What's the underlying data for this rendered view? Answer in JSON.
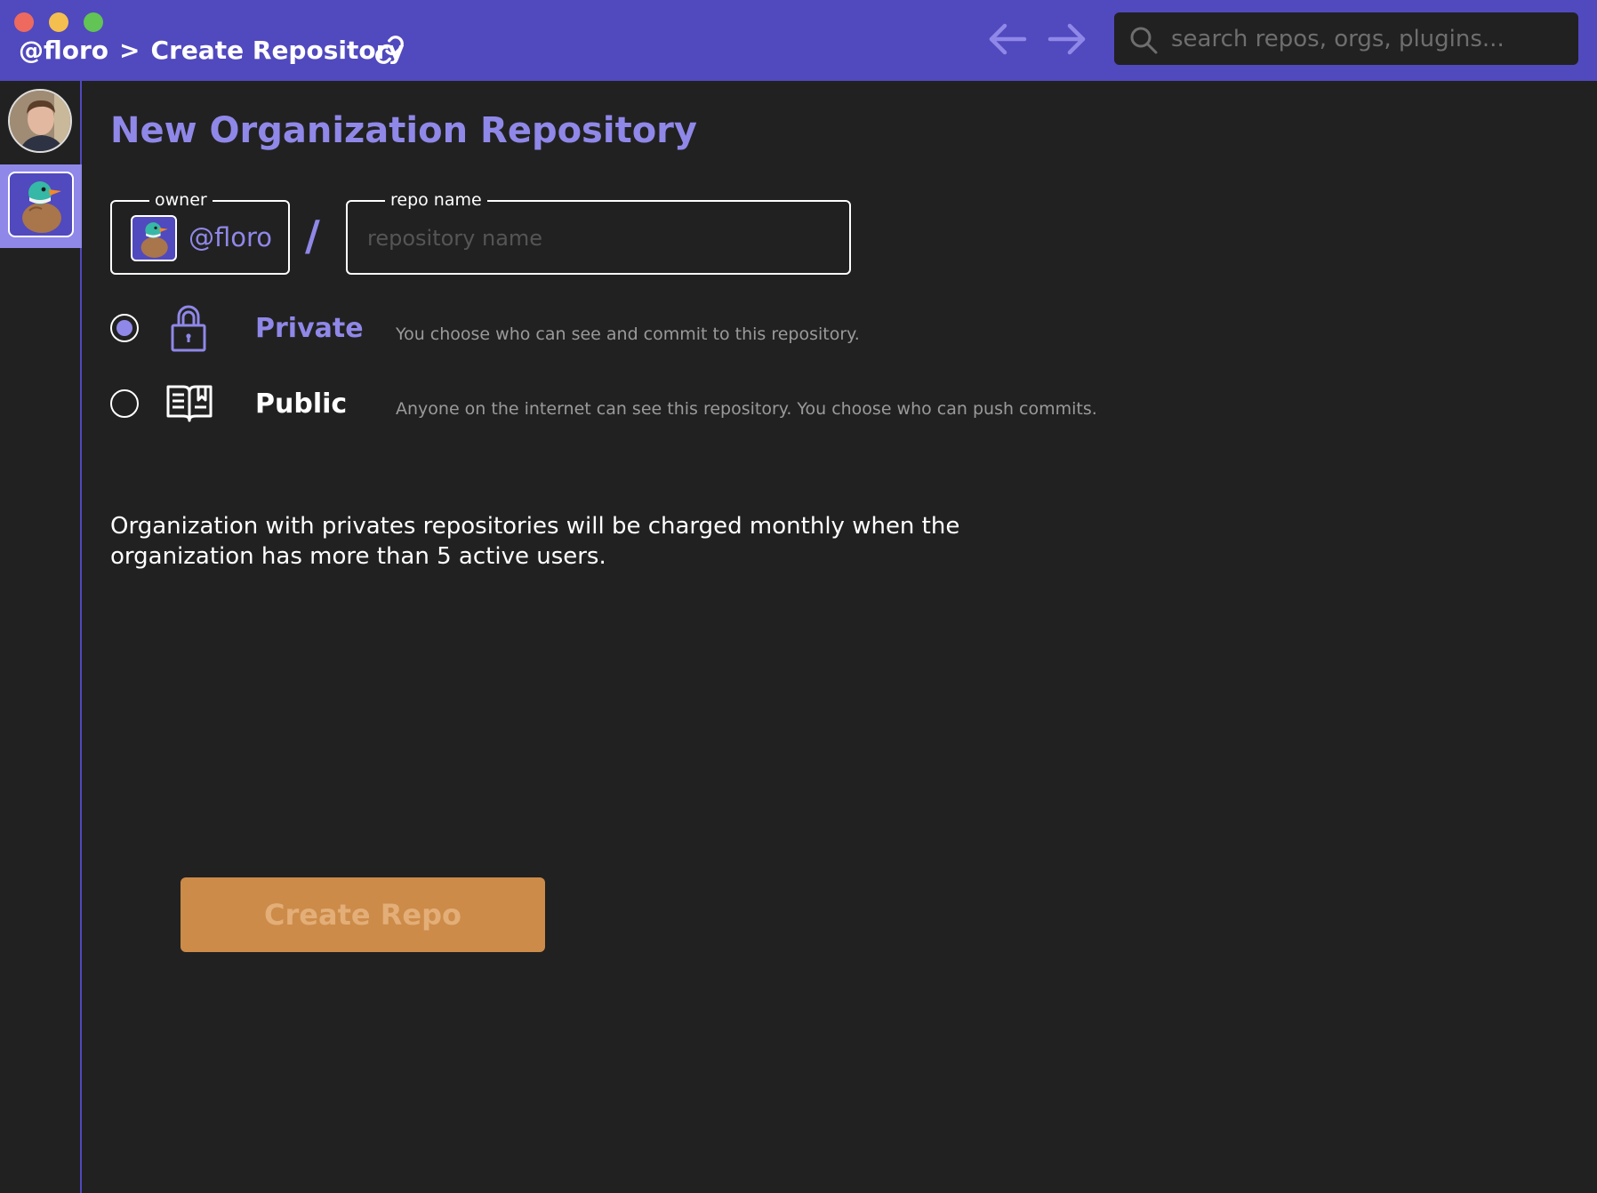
{
  "window": {
    "breadcrumb": {
      "owner": "@floro",
      "separator": ">",
      "page": "Create Repository"
    },
    "search": {
      "placeholder": "search repos, orgs, plugins..."
    },
    "icons": {
      "link": "link-icon",
      "back": "arrow-left-icon",
      "forward": "arrow-right-icon",
      "search": "search-icon"
    }
  },
  "sidebar": {
    "items": [
      {
        "name": "user-avatar",
        "kind": "photo"
      },
      {
        "name": "org-duck-logo",
        "kind": "logo",
        "active": true
      }
    ]
  },
  "main": {
    "title": "New Organization Repository",
    "owner": {
      "legend": "owner",
      "handle": "@floro"
    },
    "slash": "/",
    "repo_name": {
      "legend": "repo name",
      "placeholder": "repository name",
      "value": ""
    },
    "visibility": [
      {
        "label": "Private",
        "description": "You choose who can see and commit to this repository.",
        "icon": "lock-icon",
        "selected": true
      },
      {
        "label": "Public",
        "description": "Anyone on the internet can see this repository. You choose who can push commits.",
        "icon": "book-icon",
        "selected": false
      }
    ],
    "notice": "Organization with privates repositories will be charged monthly when the organization has more than 5 active users.",
    "create_button": "Create Repo"
  },
  "colors": {
    "topbar": "#5149BE",
    "accent": "#8F88E8",
    "background": "#212121",
    "button": "#CC8B48",
    "button_text_disabled": "#E3AE78"
  }
}
